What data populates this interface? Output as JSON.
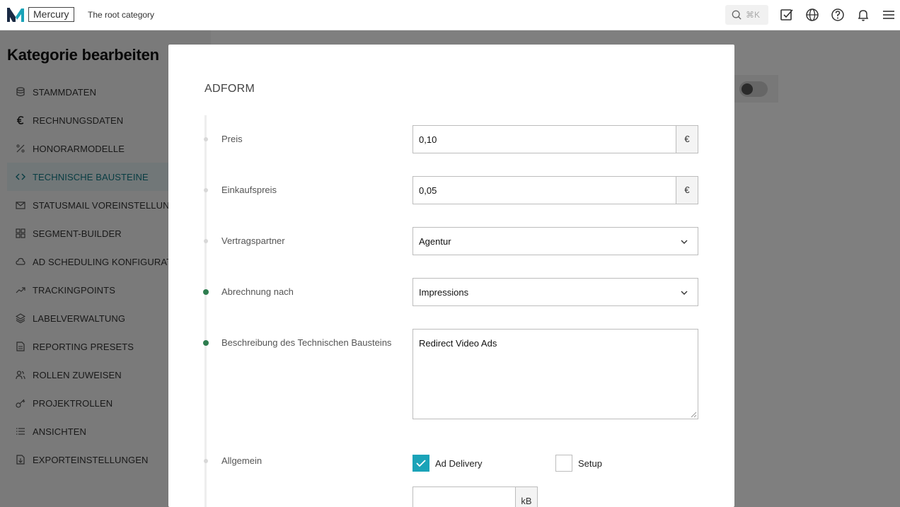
{
  "topbar": {
    "brand": "Mercury",
    "root_category": "The root category",
    "search_shortcut": "⌘K",
    "icons": [
      "search-icon",
      "task-check-icon",
      "globe-icon",
      "help-icon",
      "bell-icon",
      "menu-icon"
    ]
  },
  "page": {
    "title": "Kategorie bearbeiten",
    "nav": [
      {
        "label": "STAMMDATEN",
        "icon": "database-icon",
        "active": false
      },
      {
        "label": "RECHNUNGSDATEN",
        "icon": "euro-icon",
        "active": false
      },
      {
        "label": "HONORARMODELLE",
        "icon": "percent-icon",
        "active": false
      },
      {
        "label": "TECHNISCHE BAUSTEINE",
        "icon": "code-icon",
        "active": true
      },
      {
        "label": "STATUSMAIL VOREINSTELLUNGEN",
        "icon": "mail-icon",
        "active": false
      },
      {
        "label": "SEGMENT-BUILDER",
        "icon": "grid-icon",
        "active": false
      },
      {
        "label": "AD SCHEDULING KONFIGURATION",
        "icon": "cloud-icon",
        "active": false
      },
      {
        "label": "TRACKINGPOINTS",
        "icon": "trend-icon",
        "active": false
      },
      {
        "label": "LABELVERWALTUNG",
        "icon": "layers-icon",
        "active": false
      },
      {
        "label": "REPORTING PRESETS",
        "icon": "document-icon",
        "active": false
      },
      {
        "label": "ROLLEN ZUWEISEN",
        "icon": "users-icon",
        "active": false
      },
      {
        "label": "PROJEKTROLLEN",
        "icon": "key-icon",
        "active": false
      },
      {
        "label": "ANSICHTEN",
        "icon": "list-icon",
        "active": false
      },
      {
        "label": "EXPORTEINSTELLUNGEN",
        "icon": "file-export-icon",
        "active": false
      }
    ]
  },
  "modal": {
    "title": "ADFORM",
    "fields": {
      "preis": {
        "label": "Preis",
        "value": "0,10",
        "unit": "€"
      },
      "einkaufspreis": {
        "label": "Einkaufspreis",
        "value": "0,05",
        "unit": "€"
      },
      "vertragspartner": {
        "label": "Vertragspartner",
        "value": "Agentur"
      },
      "abrechnung": {
        "label": "Abrechnung nach",
        "value": "Impressions"
      },
      "beschreibung": {
        "label": "Beschreibung des Technischen Bausteins",
        "value": "Redirect Video Ads"
      },
      "allgemein": {
        "label": "Allgemein",
        "options": [
          {
            "label": "Ad Delivery",
            "checked": true
          },
          {
            "label": "Setup",
            "checked": false
          }
        ]
      },
      "size": {
        "value": "",
        "unit": "kB"
      }
    },
    "colors": {
      "accent": "#1aa3b8",
      "active_dot": "#2e7d4f",
      "active_nav": "#137a86"
    }
  }
}
